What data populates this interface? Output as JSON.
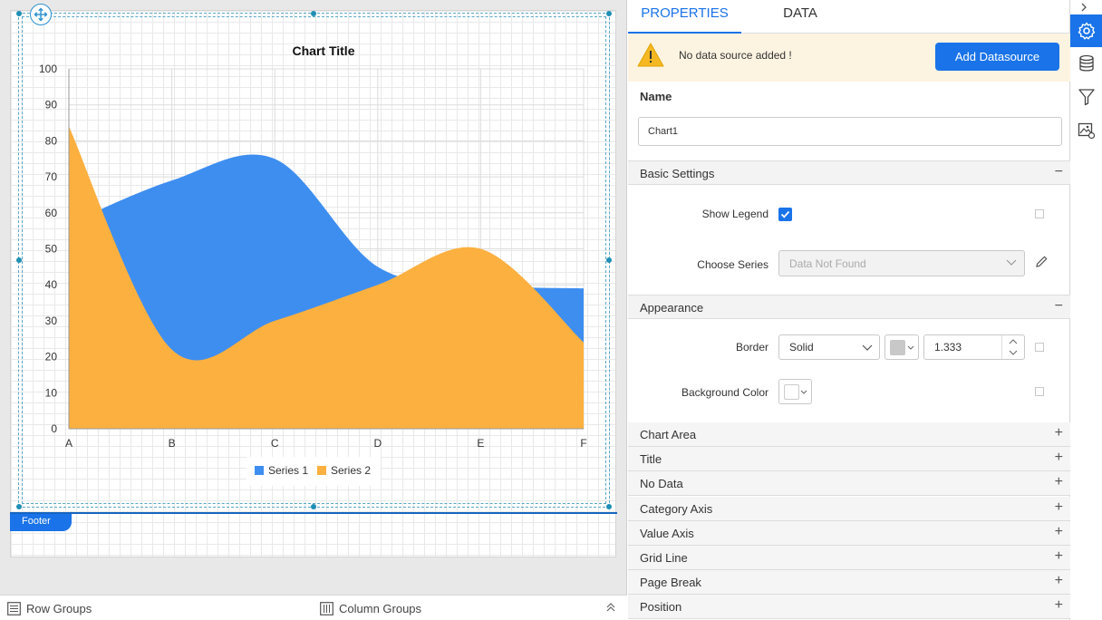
{
  "chart_data": {
    "type": "area",
    "title": "Chart Title",
    "categories": [
      "A",
      "B",
      "C",
      "D",
      "E",
      "F"
    ],
    "ylim": [
      0,
      100
    ],
    "yticks": [
      0,
      10,
      20,
      30,
      40,
      50,
      60,
      70,
      80,
      90,
      100
    ],
    "series": [
      {
        "name": "Series 1",
        "color": "#3e8ef0",
        "values": [
          57,
          69,
          75,
          45,
          40,
          39
        ]
      },
      {
        "name": "Series 2",
        "color": "#fbb040",
        "values": [
          84,
          22,
          30,
          40,
          50,
          24
        ]
      }
    ],
    "legend": "bottom",
    "grid": true
  },
  "designer": {
    "footer_label": "Footer",
    "row_groups_label": "Row Groups",
    "column_groups_label": "Column Groups"
  },
  "panel": {
    "tab_properties": "PROPERTIES",
    "tab_data": "DATA",
    "warning_text": "No data source added !",
    "add_datasource_label": "Add Datasource",
    "name_label": "Name",
    "name_value": "Chart1",
    "basic_settings": {
      "title": "Basic Settings",
      "sign": "−",
      "show_legend_label": "Show Legend",
      "show_legend_checked": true,
      "choose_series_label": "Choose Series",
      "choose_series_placeholder": "Data Not Found"
    },
    "appearance": {
      "title": "Appearance",
      "sign": "−",
      "border_label": "Border",
      "border_style": "Solid",
      "border_color": "#c8c8c8",
      "border_width": "1.333",
      "background_color_label": "Background Color"
    },
    "collapsed_sections": [
      {
        "title": "Chart Area",
        "sign": "+"
      },
      {
        "title": "Title",
        "sign": "+"
      },
      {
        "title": "No Data",
        "sign": "+"
      },
      {
        "title": "Category Axis",
        "sign": "+"
      },
      {
        "title": "Value Axis",
        "sign": "+"
      },
      {
        "title": "Grid Line",
        "sign": "+"
      },
      {
        "title": "Page Break",
        "sign": "+"
      },
      {
        "title": "Position",
        "sign": "+"
      }
    ]
  },
  "colors": {
    "accent": "#1a73e8",
    "warning_bg": "#fdf3e1",
    "warning_icon": "#f5b822"
  }
}
